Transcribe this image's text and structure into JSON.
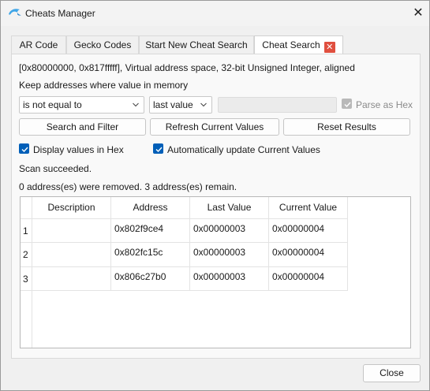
{
  "window": {
    "title": "Cheats Manager",
    "close_glyph": "✕"
  },
  "tabs": [
    {
      "label": "AR Code"
    },
    {
      "label": "Gecko Codes"
    },
    {
      "label": "Start New Cheat Search"
    },
    {
      "label": "Cheat Search",
      "active": true,
      "close_glyph": "✕"
    }
  ],
  "search": {
    "range_info": "[0x80000000, 0x817fffff], Virtual address space, 32-bit Unsigned Integer, aligned",
    "keep_label": "Keep addresses where value in memory",
    "comparison_value": "is not equal to",
    "compare_to_value": "last value",
    "value_input": "",
    "parse_as_hex_label": "Parse as Hex",
    "parse_as_hex_checked": true,
    "search_button": "Search and Filter",
    "refresh_button": "Refresh Current Values",
    "reset_button": "Reset Results",
    "display_hex_label": "Display values in Hex",
    "display_hex_checked": true,
    "auto_update_label": "Automatically update Current Values",
    "auto_update_checked": true,
    "status": "Scan succeeded.",
    "summary": "0 address(es) were removed. 3 address(es) remain."
  },
  "table": {
    "columns": [
      "Description",
      "Address",
      "Last Value",
      "Current Value"
    ],
    "rows": [
      {
        "index": "1",
        "description": "",
        "address": "0x802f9ce4",
        "last_value": "0x00000003",
        "current_value": "0x00000004"
      },
      {
        "index": "2",
        "description": "",
        "address": "0x802fc15c",
        "last_value": "0x00000003",
        "current_value": "0x00000004"
      },
      {
        "index": "3",
        "description": "",
        "address": "0x806c27b0",
        "last_value": "0x00000003",
        "current_value": "0x00000004"
      }
    ]
  },
  "footer": {
    "close_button": "Close"
  },
  "colors": {
    "accent": "#005fb8",
    "tab_close": "#e04f3f",
    "disabled": "#b9b9b9"
  }
}
